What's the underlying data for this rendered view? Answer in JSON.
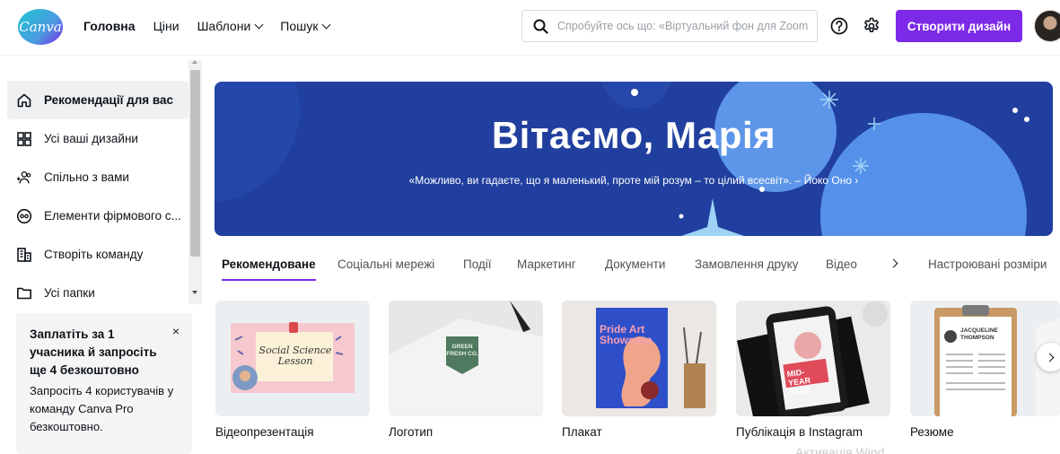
{
  "header": {
    "logo_text": "Canva",
    "nav": [
      {
        "label": "Головна",
        "active": true,
        "dropdown": false
      },
      {
        "label": "Ціни",
        "active": false,
        "dropdown": false
      },
      {
        "label": "Шаблони",
        "active": false,
        "dropdown": true
      },
      {
        "label": "Пошук",
        "active": false,
        "dropdown": true
      }
    ],
    "search": {
      "placeholder": "Спробуйте ось що: «Віртуальний фон для Zoom»"
    },
    "help_icon": "help-circle-icon",
    "settings_icon": "gear-icon",
    "create_button": "Створити дизайн"
  },
  "sidebar": {
    "items": [
      {
        "label": "Рекомендації для вас",
        "icon": "home-icon",
        "active": true
      },
      {
        "label": "Усі ваші дизайни",
        "icon": "grid-icon",
        "active": false
      },
      {
        "label": "Спільно з вами",
        "icon": "shared-users-icon",
        "active": false
      },
      {
        "label": "Елементи фірмового с...",
        "icon": "brand-kit-icon",
        "active": false
      },
      {
        "label": "Створіть команду",
        "icon": "team-building-icon",
        "active": false
      },
      {
        "label": "Усі папки",
        "icon": "folder-icon",
        "active": false
      }
    ],
    "promo": {
      "title": "Заплатіть за 1 учасника й запросіть ще 4 безкоштовно",
      "text": "Запросіть 4 користувачів у команду Canva Pro безкоштовно.",
      "close": "×"
    }
  },
  "hero": {
    "title": "Вітаємо, Марія",
    "quote": "«Можливо, ви гадаєте, що я маленький, проте мій розум – то цілий всесвіт». – Йоко Оно ›"
  },
  "tabs": [
    {
      "label": "Рекомендоване",
      "active": true
    },
    {
      "label": "Соціальні мережі",
      "active": false
    },
    {
      "label": "Події",
      "active": false
    },
    {
      "label": "Маркетинг",
      "active": false
    },
    {
      "label": "Документи",
      "active": false
    },
    {
      "label": "Замовлення друку",
      "active": false
    },
    {
      "label": "Відео",
      "active": false
    },
    {
      "label": "Настроювані розміри",
      "active": false
    }
  ],
  "cards": [
    {
      "label": "Відеопрезентація",
      "thumb_text": "Social Science Lesson"
    },
    {
      "label": "Логотип",
      "thumb_text": "GREEN FRESH CO."
    },
    {
      "label": "Плакат",
      "thumb_text": "Pride Art Showcase"
    },
    {
      "label": "Публікація в Instagram",
      "thumb_text": "MID-YEAR SALE"
    },
    {
      "label": "Резюме",
      "thumb_text": "JACQUELINE THOMPSON"
    }
  ],
  "watermark": "Активація Wind",
  "colors": {
    "brand_purple": "#7d2ae8",
    "hero_blue": "#203f9e",
    "active_bg": "#eef0f2"
  }
}
